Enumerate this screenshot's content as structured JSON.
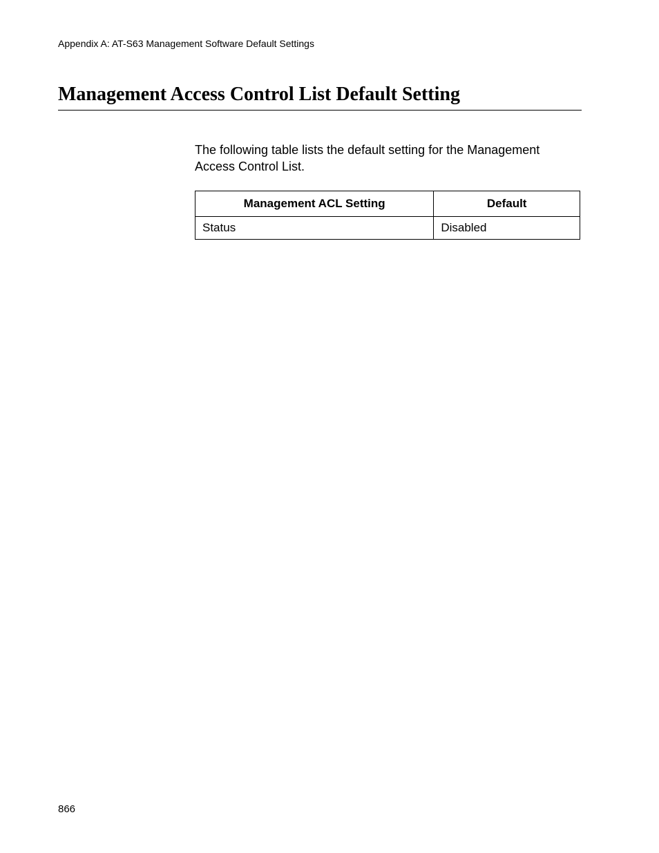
{
  "header": {
    "breadcrumb": "Appendix A: AT-S63 Management Software Default Settings"
  },
  "title": "Management Access Control List Default Setting",
  "intro": "The following table lists the default setting for the Management Access Control List.",
  "table": {
    "headers": {
      "setting": "Management ACL Setting",
      "default": "Default"
    },
    "rows": [
      {
        "setting": "Status",
        "default": "Disabled"
      }
    ]
  },
  "footer": {
    "page_number": "866"
  }
}
